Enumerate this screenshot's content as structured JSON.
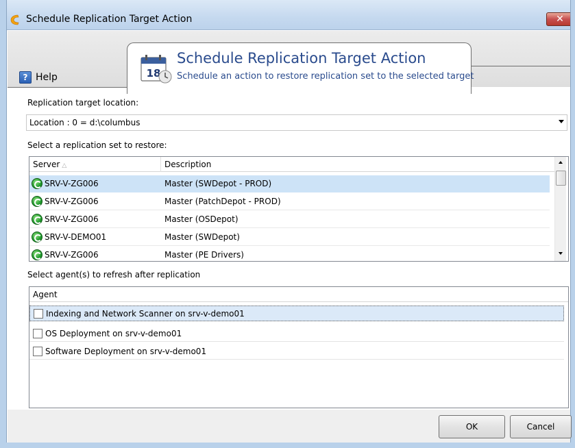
{
  "window": {
    "title": "Schedule Replication Target Action",
    "close_glyph": "✕"
  },
  "toolbar": {
    "help_label": "Help",
    "help_icon_glyph": "?"
  },
  "tab": {
    "title": "Schedule Replication Target Action",
    "subtitle": "Schedule an action to restore replication set to the selected target",
    "calendar_day": "18",
    "icon": "calendar-icon"
  },
  "target_location": {
    "label": "Replication target location:",
    "selected": "Location : 0 = d:\\columbus"
  },
  "replication_sets": {
    "label": "Select a replication set to restore:",
    "columns": [
      "Server",
      "Description"
    ],
    "sort_glyph": "△",
    "rows": [
      {
        "server": "SRV-V-ZG006",
        "description": "Master (SWDepot - PROD)",
        "selected": true
      },
      {
        "server": "SRV-V-ZG006",
        "description": "Master (PatchDepot - PROD)",
        "selected": false
      },
      {
        "server": "SRV-V-ZG006",
        "description": "Master (OSDepot)",
        "selected": false
      },
      {
        "server": "SRV-V-DEMO01",
        "description": "Master (SWDepot)",
        "selected": false
      },
      {
        "server": "SRV-V-ZG006",
        "description": "Master (PE Drivers)",
        "selected": false
      }
    ]
  },
  "agents": {
    "label": "Select agent(s) to refresh after replication",
    "column": "Agent",
    "rows": [
      {
        "name": "Indexing and Network Scanner on srv-v-demo01",
        "checked": false
      },
      {
        "name": "OS Deployment on srv-v-demo01",
        "checked": false
      },
      {
        "name": "Software Deployment on srv-v-demo01",
        "checked": false
      }
    ]
  },
  "buttons": {
    "ok": "OK",
    "cancel": "Cancel"
  },
  "colors": {
    "accent_title": "#2a4b8d",
    "selection": "#cde3f7",
    "frame": "#b9d1ea"
  }
}
